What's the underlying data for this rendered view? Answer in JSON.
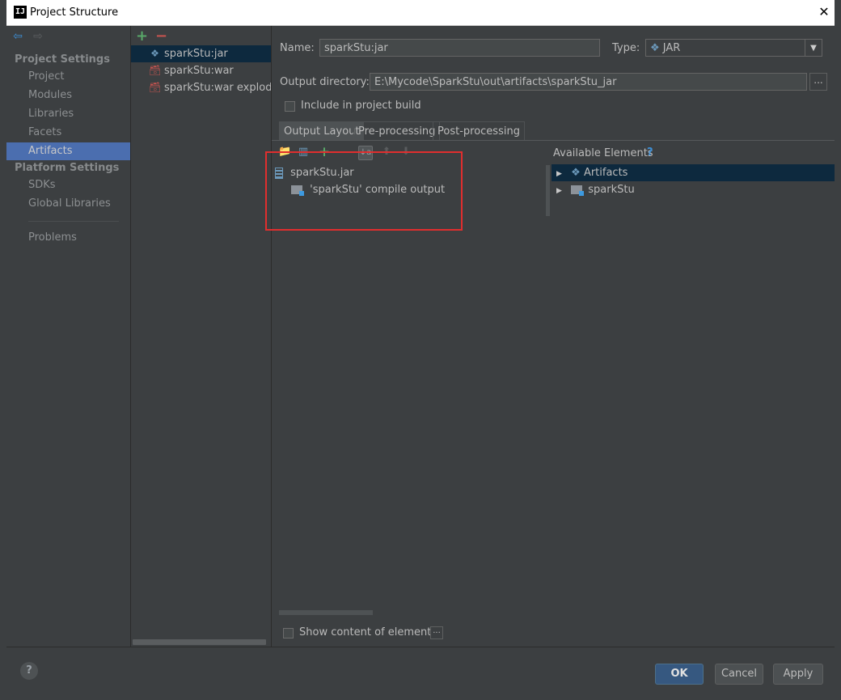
{
  "window": {
    "title": "Project Structure",
    "logo_letter": "IJ",
    "close_glyph": "✕"
  },
  "nav": {
    "back_glyph": "⇦",
    "forward_glyph": "⇨",
    "project_settings_header": "Project Settings",
    "project_settings_items": [
      "Project",
      "Modules",
      "Libraries",
      "Facets",
      "Artifacts"
    ],
    "selected_item": "Artifacts",
    "platform_settings_header": "Platform Settings",
    "platform_settings_items": [
      "SDKs",
      "Global Libraries"
    ],
    "problems_label": "Problems"
  },
  "artifacts": {
    "add_glyph": "+",
    "remove_glyph": "−",
    "items": [
      {
        "label": "sparkStu:jar",
        "icon": "artifact-jar-icon",
        "icon_glyph": "❖",
        "icon_color": "#6c99bb",
        "selected": true
      },
      {
        "label": "sparkStu:war",
        "icon": "artifact-war-icon",
        "icon_glyph": "🗃",
        "icon_color": "#c75450",
        "selected": false
      },
      {
        "label": "sparkStu:war exploded",
        "icon": "artifact-war-exploded-icon",
        "icon_glyph": "🗃",
        "icon_color": "#c75450",
        "selected": false
      }
    ]
  },
  "details": {
    "name_label": "Name:",
    "name_value": "sparkStu:jar",
    "type_label": "Type:",
    "type_value": "JAR",
    "type_icon_glyph": "❖",
    "dropdown_glyph": "▼",
    "output_dir_label": "Output directory:",
    "output_dir_value": "E:\\Mycode\\SparkStu\\out\\artifacts\\sparkStu_jar",
    "browse_label": "...",
    "include_build_label": "Include in project build",
    "include_build_checked": false,
    "tabs": [
      "Output Layout",
      "Pre-processing",
      "Post-processing"
    ],
    "active_tab": "Output Layout"
  },
  "layout_toolbar": {
    "new_dir_glyph": "📁",
    "jar_glyph": "▥",
    "add_glyph": "+",
    "sort_glyph": "↓a",
    "up_glyph": "⬆",
    "down_glyph": "⬇"
  },
  "output_tree": {
    "root": "sparkStu.jar",
    "children": [
      "'sparkStu' compile output"
    ]
  },
  "available": {
    "title": "Available Elements",
    "help_glyph": "?",
    "expand_glyph": "▶",
    "items": [
      {
        "label": "Artifacts",
        "icon": "artifacts-icon",
        "selected": true
      },
      {
        "label": "sparkStu",
        "icon": "module-folder-icon",
        "selected": false
      }
    ]
  },
  "show_content_label": "Show content of elements",
  "show_content_checked": false,
  "show_content_btn": "...",
  "footer": {
    "help_glyph": "?",
    "ok_label": "OK",
    "cancel_label": "Cancel",
    "apply_label": "Apply"
  },
  "colors": {
    "accent_selected": "#4b6eaf",
    "tree_selected": "#0d293e",
    "highlight_box": "#e02e2e"
  }
}
